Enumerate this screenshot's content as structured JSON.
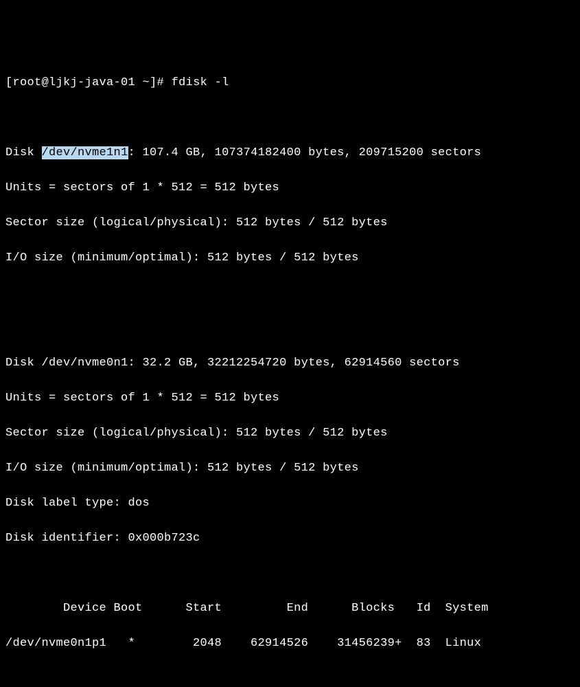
{
  "prompt": {
    "user_host": "[root@ljkj-java-01 ~]#",
    "command": "fdisk -l"
  },
  "disk1": {
    "prefix": "Disk ",
    "device": "/dev/nvme1n1",
    "after_device": ": 107.4 GB, 107374182400 bytes, 209715200 sectors",
    "units": "Units = sectors of 1 * 512 = 512 bytes",
    "sector_size": "Sector size (logical/physical): 512 bytes / 512 bytes",
    "io_size": "I/O size (minimum/optimal): 512 bytes / 512 bytes"
  },
  "disk2": {
    "header": "Disk /dev/nvme0n1: 32.2 GB, 32212254720 bytes, 62914560 sectors",
    "units": "Units = sectors of 1 * 512 = 512 bytes",
    "sector_size": "Sector size (logical/physical): 512 bytes / 512 bytes",
    "io_size": "I/O size (minimum/optimal): 512 bytes / 512 bytes",
    "label_type": "Disk label type: dos",
    "identifier": "Disk identifier: 0x000b723c"
  },
  "partition_table": {
    "header": "        Device Boot      Start         End      Blocks   Id  System",
    "row1": "/dev/nvme0n1p1   *        2048    62914526    31456239+  83  Linux"
  }
}
